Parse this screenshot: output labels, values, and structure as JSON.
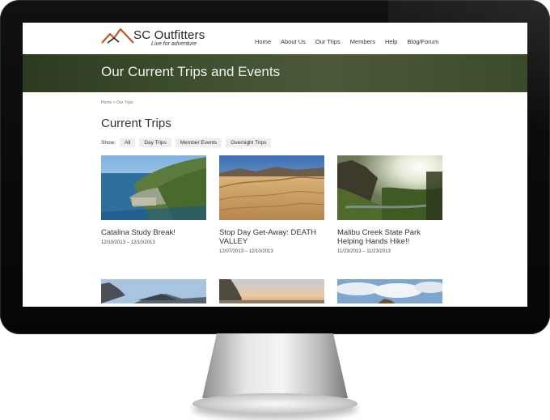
{
  "site": {
    "logo_name": "SC Outfitters",
    "logo_tagline": "Live for adventure"
  },
  "nav": {
    "items": [
      {
        "label": "Home"
      },
      {
        "label": "About Us"
      },
      {
        "label": "Our Trips"
      },
      {
        "label": "Members"
      },
      {
        "label": "Help"
      },
      {
        "label": "Blog/Forum"
      }
    ]
  },
  "banner": {
    "title": "Our Current Trips and Events"
  },
  "breadcrumb": "Home > Our Trips",
  "section": {
    "title": "Current Trips"
  },
  "filters": {
    "label": "Show:",
    "options": [
      "All",
      "Day Trips",
      "Member Events",
      "Overnight Trips"
    ]
  },
  "trips": [
    {
      "title": "Catalina Study Break!",
      "dates": "12/10/2013 – 12/10/2013",
      "image": "coastal-harbor-photo"
    },
    {
      "title": "Stop Day Get-Away: DEATH VALLEY",
      "dates": "12/07/2013 – 12/10/2013",
      "image": "desert-dunes-photo"
    },
    {
      "title": "Malibu Creek State Park Helping Hands Hike!!",
      "dates": "11/23/2013 – 11/23/2013",
      "image": "canyon-creek-photo"
    }
  ],
  "trips_row2": [
    {
      "image": "mountain-sky-photo"
    },
    {
      "image": "sunset-rock-photo"
    },
    {
      "image": "cloudy-summit-photo"
    }
  ]
}
